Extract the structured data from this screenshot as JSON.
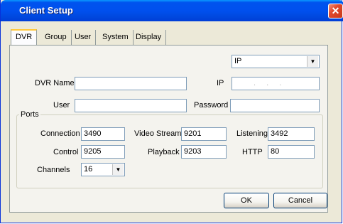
{
  "window": {
    "title": "Client Setup",
    "close_glyph": "✕"
  },
  "tabs": [
    "DVR",
    "Group",
    "User",
    "System",
    "Display"
  ],
  "connection_type": {
    "selected": "IP"
  },
  "fields": {
    "dvr_name": {
      "label": "DVR Name",
      "value": ""
    },
    "ip": {
      "label": "IP",
      "value": ". . ."
    },
    "user": {
      "label": "User",
      "value": ""
    },
    "password": {
      "label": "Password",
      "value": ""
    }
  },
  "ports": {
    "title": "Ports",
    "connection": {
      "label": "Connection",
      "value": "3490"
    },
    "video_stream": {
      "label": "Video Stream",
      "value": "9201"
    },
    "listening": {
      "label": "Listening",
      "value": "3492"
    },
    "control": {
      "label": "Control",
      "value": "9205"
    },
    "playback": {
      "label": "Playback",
      "value": "9203"
    },
    "http": {
      "label": "HTTP",
      "value": "80"
    },
    "channels": {
      "label": "Channels",
      "value": "16"
    }
  },
  "buttons": {
    "ok": "OK",
    "cancel": "Cancel"
  }
}
